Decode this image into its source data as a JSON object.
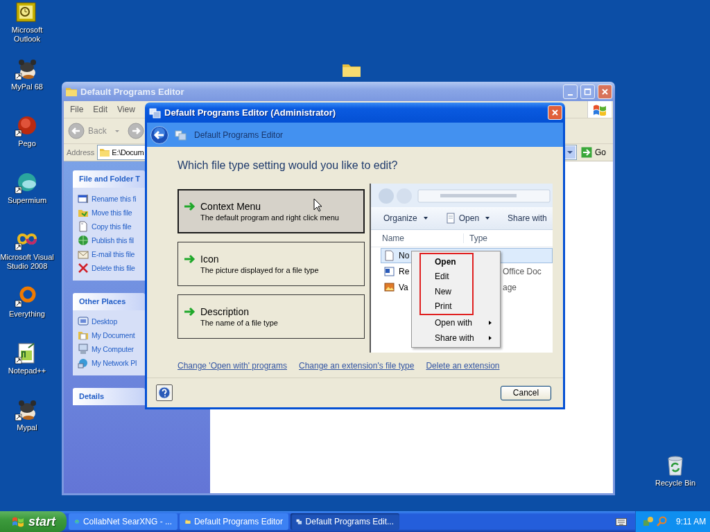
{
  "desktop_icons": [
    {
      "label": "Microsoft Outlook"
    },
    {
      "label": "MyPal 68"
    },
    {
      "label": "Pego"
    },
    {
      "label": "Supermium"
    },
    {
      "label": "Microsoft Visual Studio 2008"
    },
    {
      "label": "Everything"
    },
    {
      "label": "Notepad++"
    },
    {
      "label": "Mypal"
    }
  ],
  "recycle_bin": {
    "label": "Recycle Bin"
  },
  "explorer": {
    "title": "Default Programs Editor",
    "menu": [
      "File",
      "Edit",
      "View"
    ],
    "back": "Back",
    "address_label": "Address",
    "address": "E:\\Docum",
    "go": "Go",
    "panels": [
      {
        "title": "File and Folder T",
        "items": [
          "Rename this fi",
          "Move this file",
          "Copy this file",
          "Publish this fil",
          "E-mail this file",
          "Delete this file"
        ]
      },
      {
        "title": "Other Places",
        "items": [
          "Desktop",
          "My Document",
          "My Computer",
          "My Network Pl"
        ]
      },
      {
        "title": "Details"
      }
    ]
  },
  "dialog": {
    "title": "Default Programs Editor (Administrator)",
    "nav_title": "Default Programs Editor",
    "heading": "Which file type setting would you like to edit?",
    "options": [
      {
        "title": "Context Menu",
        "description": "The default program and right click menu",
        "selected": true
      },
      {
        "title": "Icon",
        "description": "The picture displayed for a file type",
        "selected": false
      },
      {
        "title": "Description",
        "description": "The name of a file type",
        "selected": false
      }
    ],
    "preview": {
      "toolbar": [
        "Organize",
        "Open",
        "Share with"
      ],
      "columns": [
        "Name",
        "Type"
      ],
      "files": [
        {
          "name": "No",
          "selected": true
        },
        {
          "name": "Re",
          "type": "Office Doc",
          "selected": false
        },
        {
          "name": "Va",
          "type": "age",
          "selected": false
        }
      ],
      "context_menu": [
        {
          "label": "Open",
          "default": true,
          "submenu": false
        },
        {
          "label": "Edit",
          "default": false,
          "submenu": false
        },
        {
          "label": "New",
          "default": false,
          "submenu": false
        },
        {
          "label": "Print",
          "default": false,
          "submenu": false
        },
        {
          "label": "Open with",
          "default": false,
          "submenu": true
        },
        {
          "label": "Share with",
          "default": false,
          "submenu": true
        }
      ]
    },
    "links": [
      "Change 'Open with' programs",
      "Change an extension's file type",
      "Delete an extension"
    ],
    "cancel": "Cancel"
  },
  "taskbar": {
    "start": "start",
    "tasks": [
      {
        "label": "CollabNet SearXNG - ...",
        "selected": false
      },
      {
        "label": "Default Programs Editor",
        "selected": false
      },
      {
        "label": "Default Programs Edit...",
        "selected": true
      }
    ],
    "clock": "9:11 AM"
  }
}
